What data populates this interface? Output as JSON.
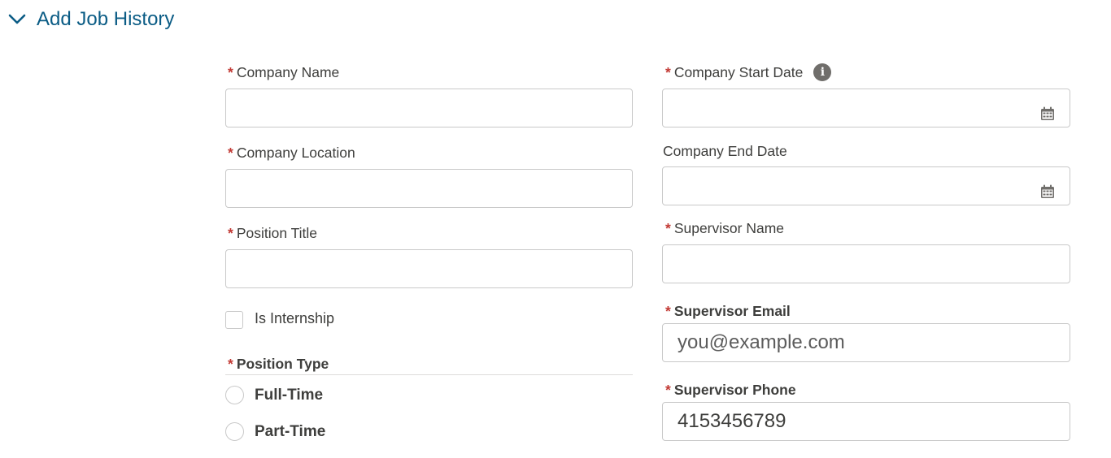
{
  "section": {
    "title": "Add Job History",
    "toggle_icon": "chevron-down-icon"
  },
  "colors": {
    "accent": "#0b5c85",
    "required": "#c23934",
    "border": "#c9c9c9",
    "text": "#3e3e3c",
    "icon": "#706e6b"
  },
  "left": {
    "company_name": {
      "label": "Company Name",
      "required": true,
      "value": ""
    },
    "company_location": {
      "label": "Company Location",
      "required": true,
      "value": ""
    },
    "position_title": {
      "label": "Position Title",
      "required": true,
      "value": ""
    },
    "is_internship": {
      "label": "Is Internship",
      "checked": false
    },
    "position_type": {
      "label": "Position Type",
      "required": true,
      "options": [
        {
          "label": "Full-Time",
          "selected": false
        },
        {
          "label": "Part-Time",
          "selected": false
        }
      ]
    }
  },
  "right": {
    "company_start_date": {
      "label": "Company Start Date",
      "required": true,
      "value": "",
      "info_icon": "info-icon",
      "picker_icon": "calendar-icon"
    },
    "company_end_date": {
      "label": "Company End Date",
      "required": false,
      "value": "",
      "picker_icon": "calendar-icon"
    },
    "supervisor_name": {
      "label": "Supervisor Name",
      "required": true,
      "value": ""
    },
    "supervisor_email": {
      "label": "Supervisor Email",
      "required": true,
      "placeholder": "you@example.com",
      "value": ""
    },
    "supervisor_phone": {
      "label": "Supervisor Phone",
      "required": true,
      "value": "4153456789"
    }
  },
  "required_marker": "*"
}
